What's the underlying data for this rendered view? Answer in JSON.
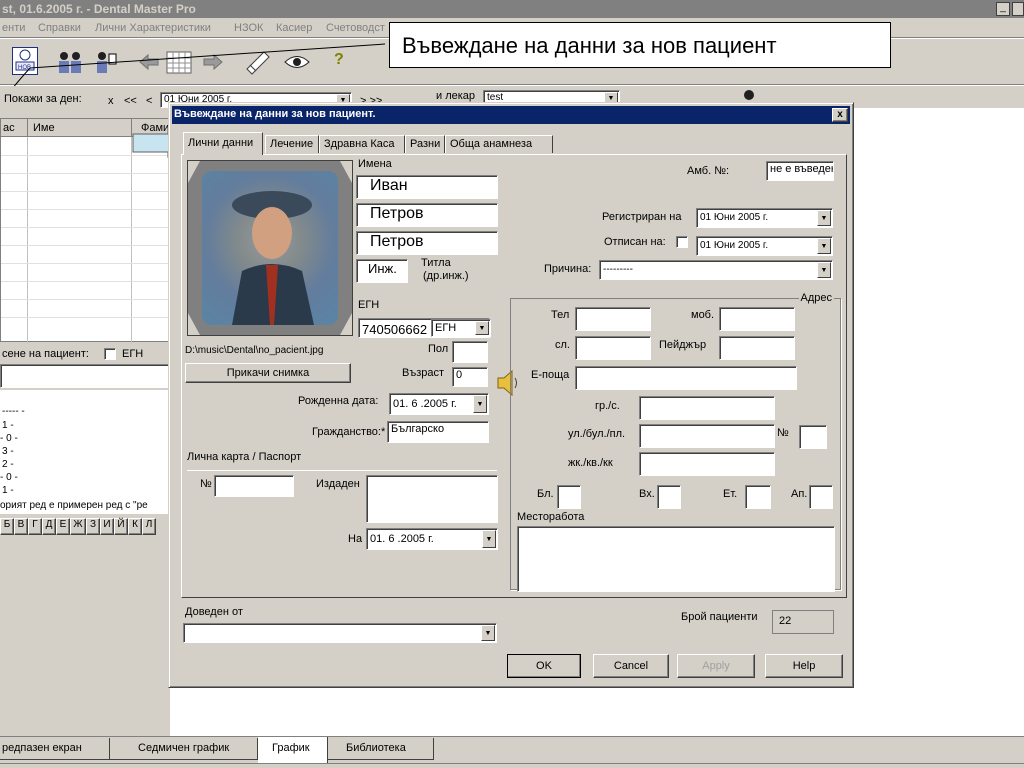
{
  "app": {
    "title": "st, 01.6.2005 г. - Dental Master Pro",
    "menu": [
      "енти",
      "Справки",
      "Лични Характеристики",
      "НЗОК",
      "Касиер",
      "Счетоводст"
    ],
    "win_ctrl": "_□"
  },
  "callout": {
    "text": "Въвеждане на данни за нов пациент"
  },
  "toolbar": {
    "show_for_day": "Покажи за ден:",
    "nav": [
      "x",
      "<<",
      "<"
    ],
    "date_value": "01      Юни        2005 г.",
    "nav_right": "> >>",
    "doctor_label": "и лекар",
    "doctor_value": "test"
  },
  "left_panel": {
    "col_hour": "ас",
    "col_name": "Име",
    "col_family": "Фами",
    "search_label": "сене на пациент:",
    "egn_label": "ЕГН",
    "lines": [
      "----- -",
      "1  -",
      "- 0  -",
      "3  -",
      "2  -",
      "- 0  -",
      "1  -"
    ],
    "note": "орият ред е примерен ред с \"ре",
    "alphabet": [
      "Б",
      "В",
      "Г",
      "Д",
      "Е",
      "Ж",
      "З",
      "И",
      "Й",
      "К",
      "Л"
    ]
  },
  "dialog": {
    "title": "Въвеждане на данни за нов пациент.",
    "close": "x",
    "tabs": [
      "Лични данни",
      "Лечение",
      "Здравна Каса",
      "Разни",
      "Обща анамнеза"
    ],
    "names_label": "Имена",
    "first_name": "Иван",
    "middle_name": "Петров",
    "last_name": "Петров",
    "title_value": "Инж.",
    "title_label": "Титла",
    "title_hint": "(др.инж.)",
    "amb_label": "Амб. №:",
    "amb_value": "не е въведен",
    "registered_label": "Регистриран на",
    "registered_value": "01     Юни      2005 г.",
    "removed_label": "Отписан на:",
    "removed_value": "01     Юни      2005 г.",
    "reason_label": "Причина:",
    "reason_value": "---------",
    "egn_label": "ЕГН",
    "egn_value": "740506662",
    "egn_type": "ЕГН",
    "photo_path": "D:\\music\\Dental\\no_pacient.jpg",
    "attach_photo": "Прикачи снимка",
    "sex_label": "Пол",
    "age_label": "Възраст",
    "age_value": "0",
    "birth_label": "Рожденна дата:",
    "birth_value": "01. 6 .2005 г.",
    "citizenship_label": "Гражданство:*",
    "citizenship_value": "Българско",
    "id_card_label": "Лична карта / Паспорт",
    "id_no_label": "№",
    "issued_label": "Издаден",
    "on_label": "На",
    "on_value": "01. 6 .2005 г.",
    "address_label": "Адрес",
    "phone_label": "Тел",
    "mobile_label": "моб.",
    "village_label": "сл.",
    "pager_label": "Пейджър",
    "email_label": "Е-поща",
    "city_label": "гр./с.",
    "street_label": "ул./бул./пл.",
    "street_no_label": "№",
    "complex_label": "жк./кв./кк",
    "block_label": "Бл.",
    "entrance_label": "Вх.",
    "floor_label": "Ет.",
    "apt_label": "Ап.",
    "workplace_label": "Месторабота",
    "referred_label": "Доведен от",
    "patients_count_label": "Брой пациенти",
    "patients_count_value": "22",
    "ok": "OK",
    "cancel": "Cancel",
    "apply": "Apply",
    "help": "Help"
  },
  "bottom_tabs": [
    "редпазен екран",
    "Седмичен график",
    "График",
    "Библиотека"
  ],
  "colors": {
    "titlebar": "#0a246a",
    "face": "#d4d0c8",
    "callout_arrow": "#c8e4f0"
  }
}
